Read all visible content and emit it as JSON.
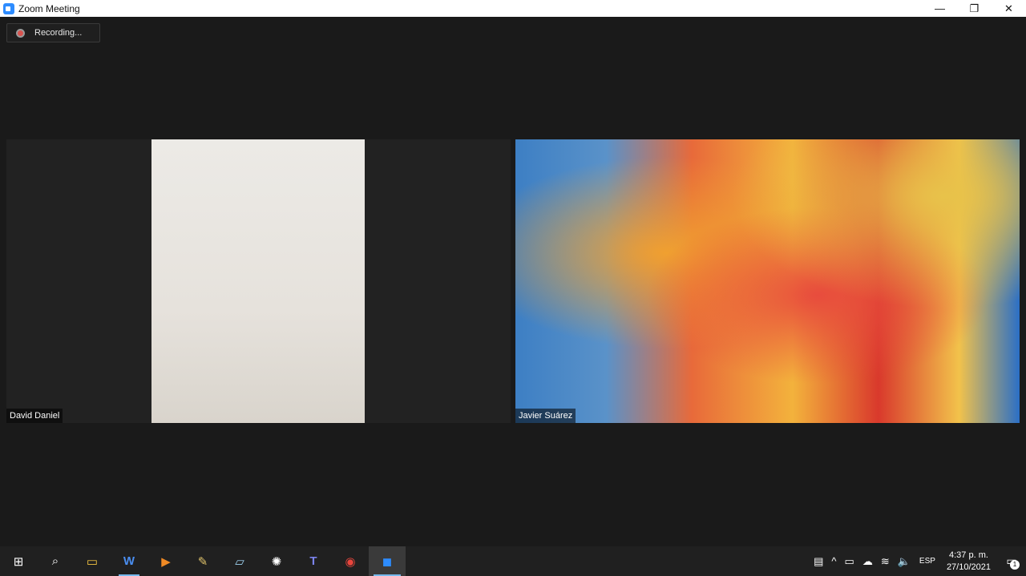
{
  "window": {
    "title": "Zoom Meeting",
    "controls": {
      "minimize": "—",
      "maximize": "❐",
      "close": "✕"
    }
  },
  "meeting": {
    "recording_label": "Recording...",
    "participants": [
      {
        "name": "David Daniel"
      },
      {
        "name": "Javier Suárez"
      }
    ]
  },
  "taskbar": {
    "items": [
      {
        "icon": "windows-start-icon",
        "glyph": "⊞"
      },
      {
        "icon": "search-icon",
        "glyph": "⌕"
      },
      {
        "icon": "file-explorer-icon",
        "glyph": "▭"
      },
      {
        "icon": "word-icon",
        "glyph": "W"
      },
      {
        "icon": "media-player-icon",
        "glyph": "▶"
      },
      {
        "icon": "paint-icon",
        "glyph": "✎"
      },
      {
        "icon": "notes-icon",
        "glyph": "▱"
      },
      {
        "icon": "app-icon",
        "glyph": "✺"
      },
      {
        "icon": "teams-icon",
        "glyph": "T"
      },
      {
        "icon": "chrome-icon",
        "glyph": "◉"
      },
      {
        "icon": "zoom-icon",
        "glyph": "◼"
      }
    ],
    "tray": {
      "news_glyph": "▤",
      "chevron_glyph": "^",
      "battery_glyph": "▭",
      "cloud_glyph": "☁",
      "wifi_glyph": "≋",
      "volume_glyph": "🔈",
      "language": "ESP",
      "time": "4:37 p. m.",
      "date": "27/10/2021",
      "notification_glyph": "▭",
      "notification_count": "1"
    }
  },
  "colors": {
    "zoom_blue": "#2d8cff",
    "taskbar_bg": "#202020",
    "meeting_bg": "#1a1a1a",
    "recording_dot": "#d9534f"
  }
}
